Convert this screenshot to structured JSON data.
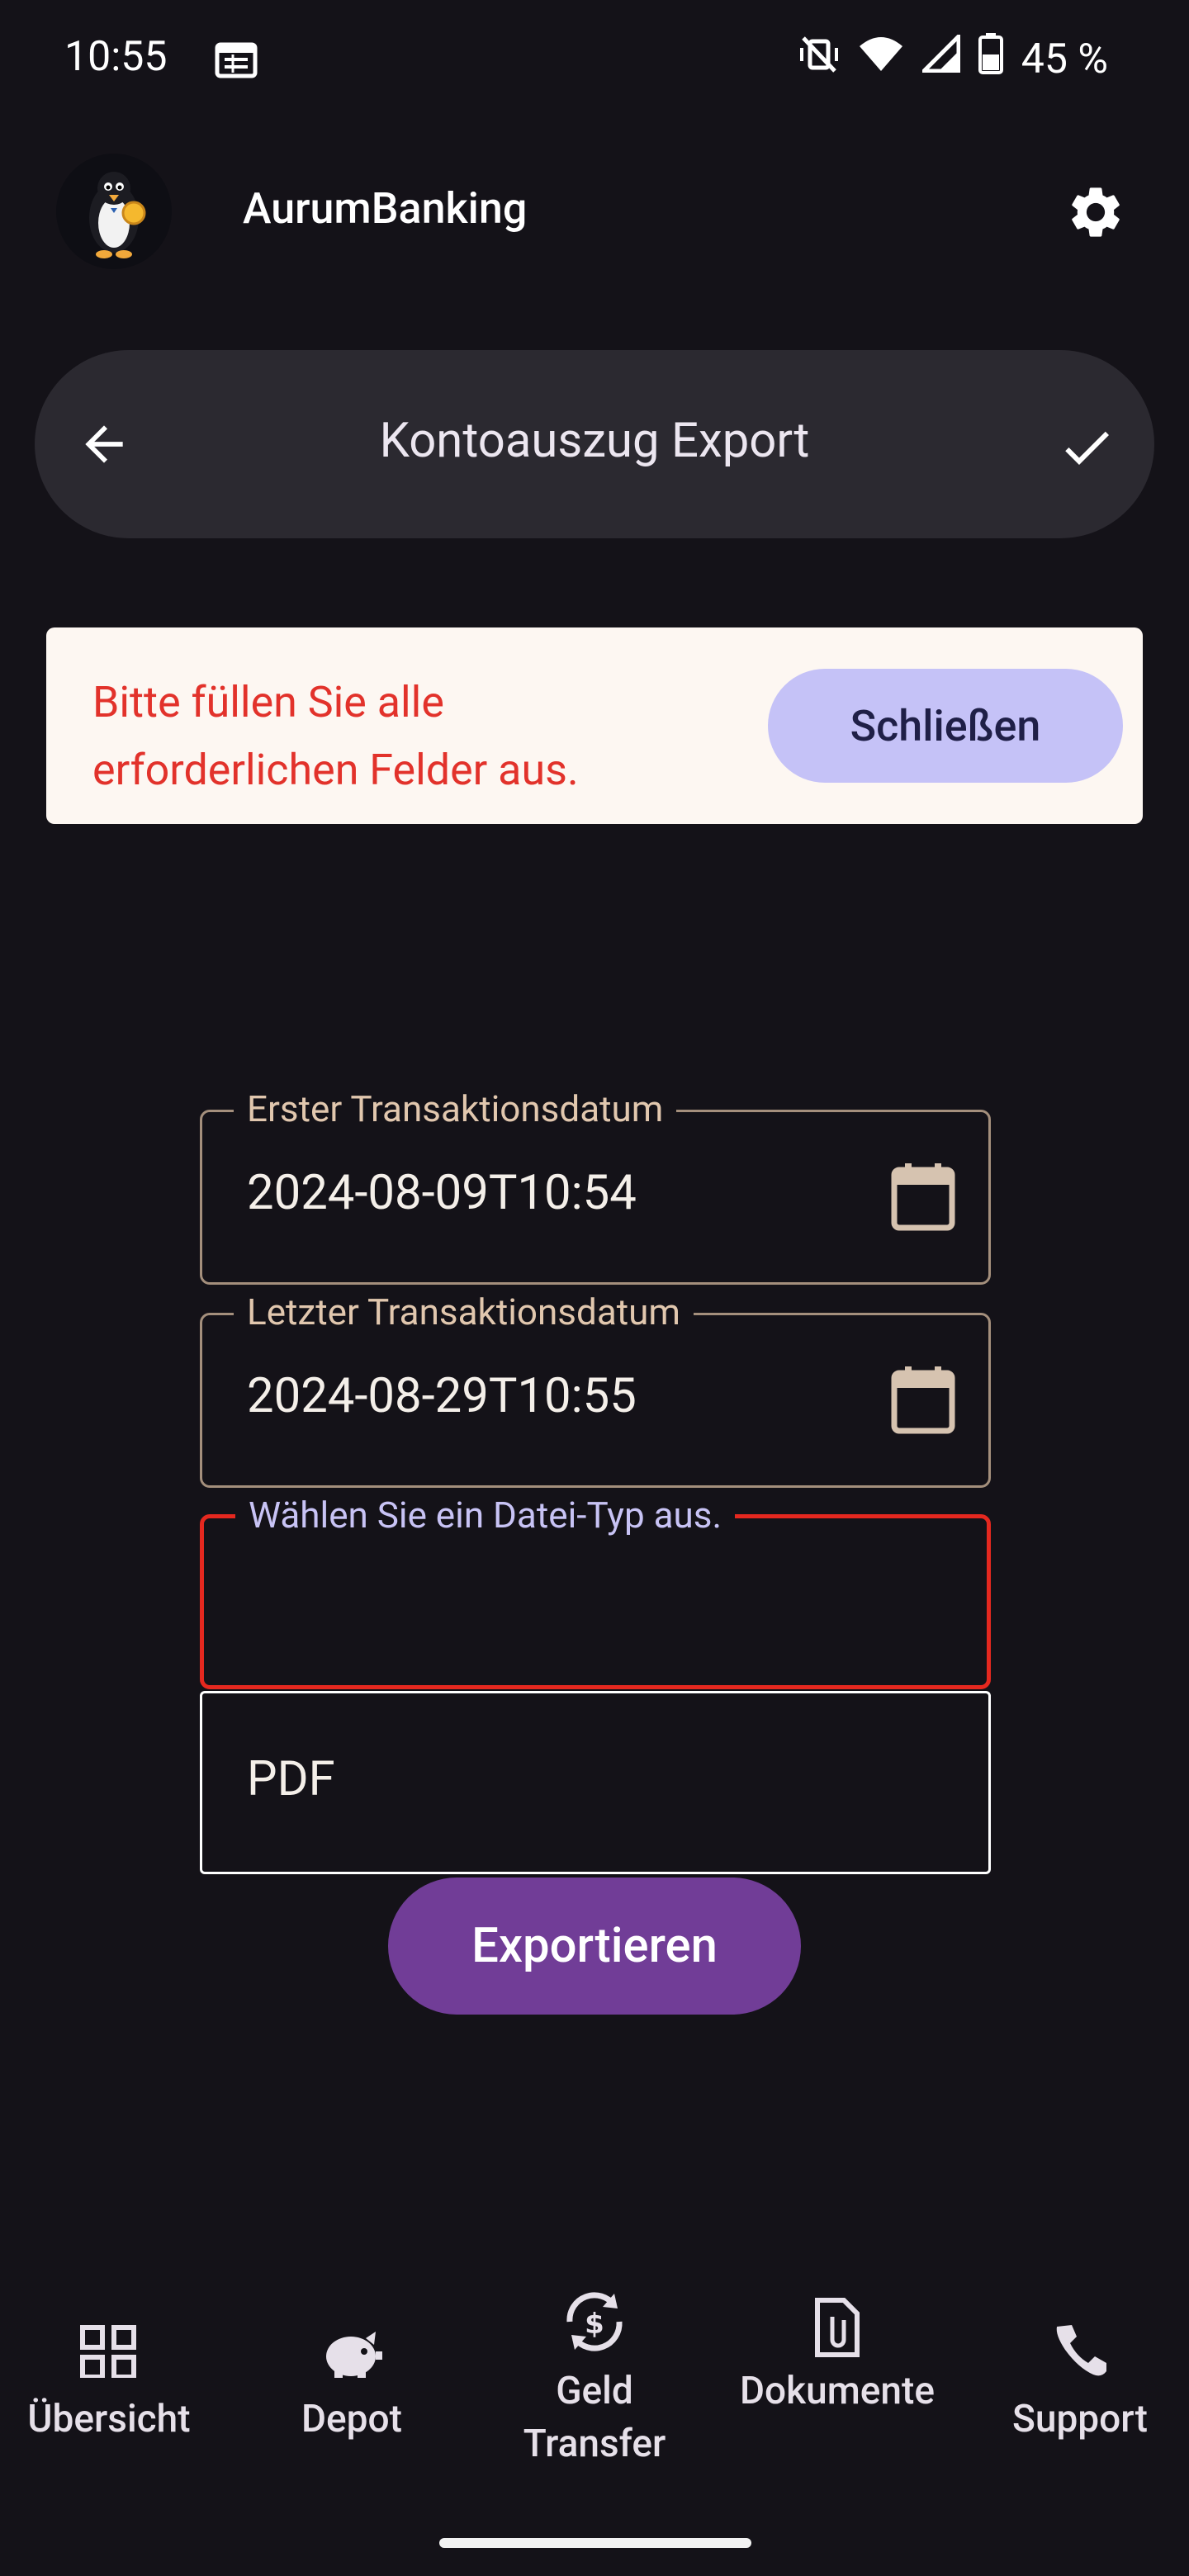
{
  "status_bar": {
    "time": "10:55",
    "battery": "45 %"
  },
  "app": {
    "name": "AurumBanking"
  },
  "header": {
    "title": "Kontoauszug Export"
  },
  "snackbar": {
    "message": "Bitte füllen Sie alle erforderlichen Felder aus.",
    "close_label": "Schließen"
  },
  "form": {
    "first_date": {
      "label": "Erster Transaktionsdatum",
      "value": "2024-08-09T10:54"
    },
    "last_date": {
      "label": "Letzter Transaktionsdatum",
      "value": "2024-08-29T10:55"
    },
    "file_type": {
      "label": "Wählen Sie ein Datei-Typ aus.",
      "value": ""
    },
    "option_pdf": "PDF",
    "export_label": "Exportieren"
  },
  "nav": {
    "items": [
      {
        "label": "Übersicht",
        "icon": "grid-icon"
      },
      {
        "label": "Depot",
        "icon": "piggy-bank-icon"
      },
      {
        "label": "Geld Transfer",
        "icon": "currency-exchange-icon"
      },
      {
        "label": "Dokumente",
        "icon": "document-attachment-icon"
      },
      {
        "label": "Support",
        "icon": "phone-icon"
      }
    ]
  },
  "colors": {
    "background": "#141218",
    "error": "#e5281f",
    "primary_button": "#713d97",
    "snackbar_button": "#c5c2f7"
  }
}
